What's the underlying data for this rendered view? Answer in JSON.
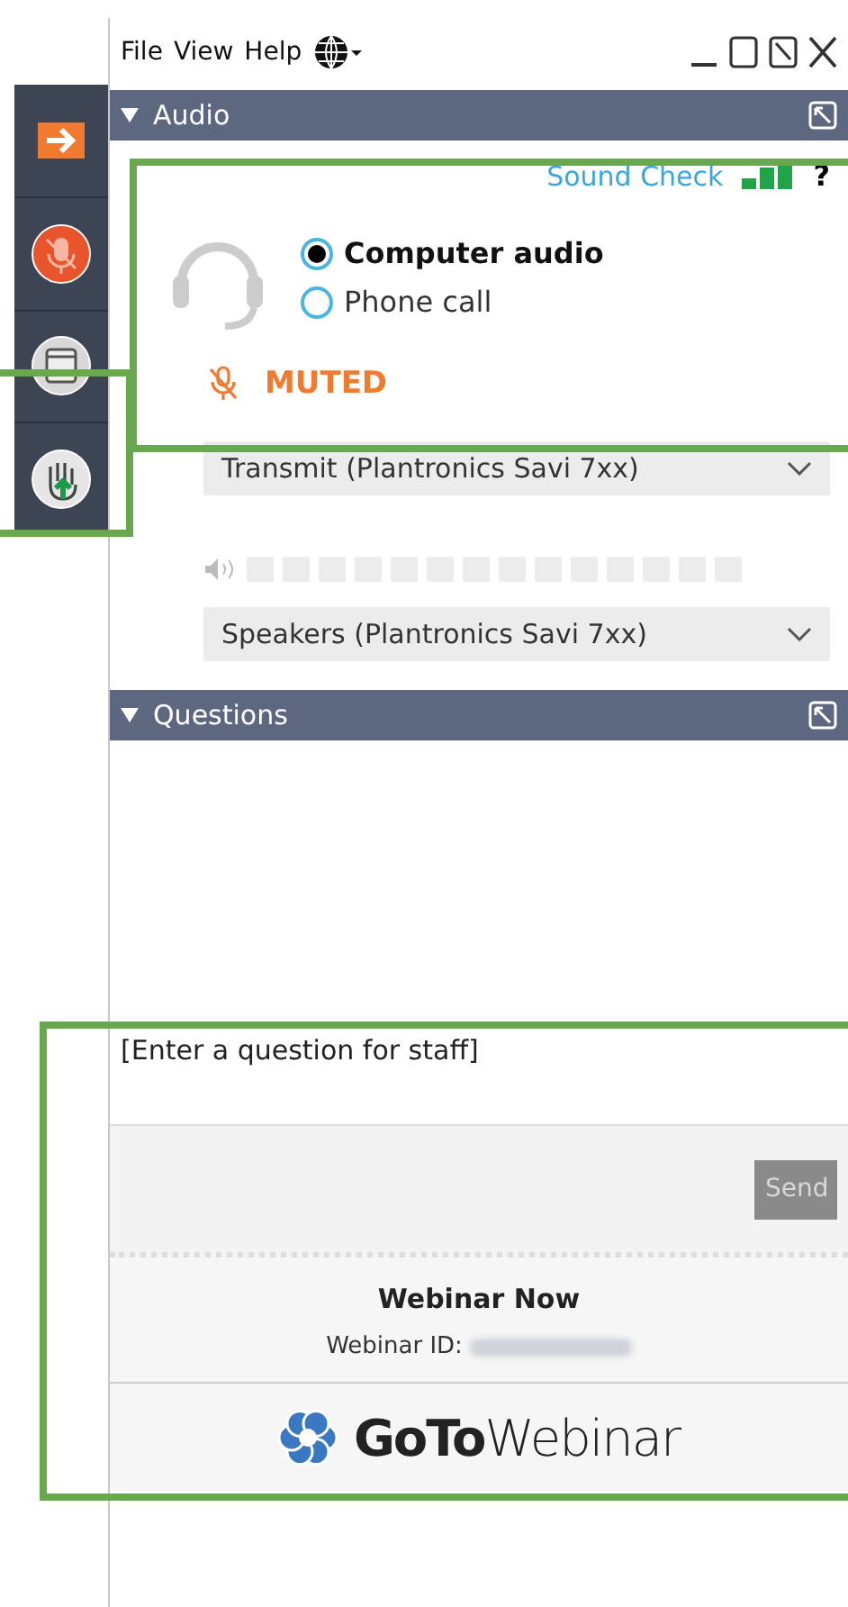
{
  "sidebar": {
    "items": [
      {
        "kind": "arrow"
      },
      {
        "kind": "mic"
      },
      {
        "kind": "window"
      },
      {
        "kind": "hand"
      }
    ]
  },
  "menu": {
    "items": [
      "File",
      "View",
      "Help"
    ]
  },
  "audio": {
    "title": "Audio",
    "expanded": true,
    "sound_check": "Sound Check",
    "help": "?",
    "options": [
      {
        "label": "Computer audio",
        "selected": true
      },
      {
        "label": "Phone call",
        "selected": false
      }
    ],
    "muted": true,
    "muted_label": "MUTED",
    "microphone": {
      "value": "Transmit (Plantronics Savi 7xx)"
    },
    "speaker_meter": {
      "level": 0
    },
    "speaker": {
      "value": "Speakers (Plantronics Savi 7xx)"
    }
  },
  "questions": {
    "title": "Questions",
    "expanded": true,
    "placeholder": "[Enter a question for staff]",
    "send": {
      "label": "Send",
      "disabled": true
    }
  },
  "footer": {
    "title": "Webinar Now",
    "id_label": "Webinar ID:",
    "logo": "**GoTo**Webinar"
  }
}
